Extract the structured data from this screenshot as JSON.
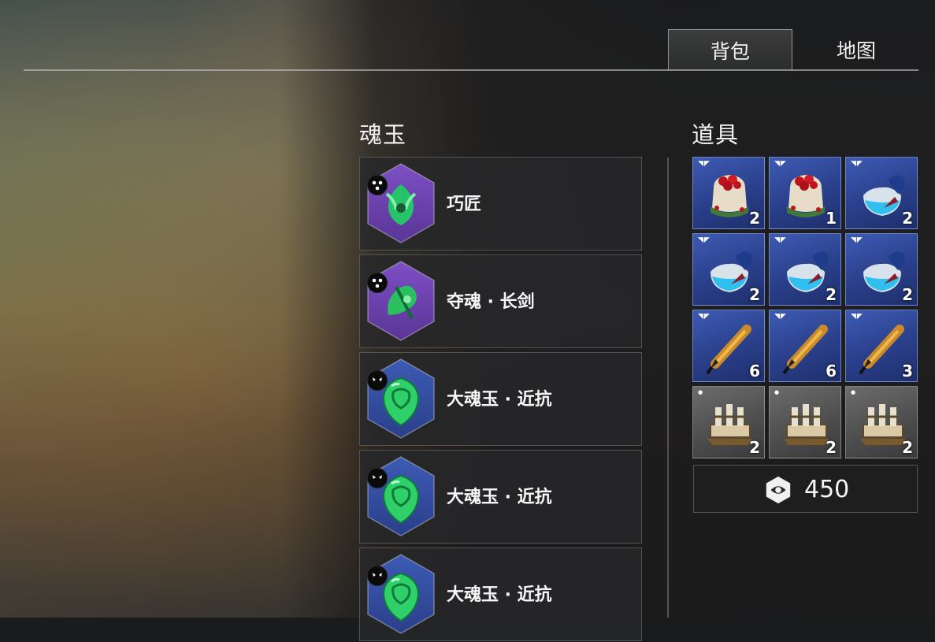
{
  "tabs": [
    {
      "label": "背包",
      "active": true
    },
    {
      "label": "地图",
      "active": false
    }
  ],
  "soul_jade": {
    "title": "魂玉",
    "items": [
      {
        "name": "巧匠",
        "rarity": "purple",
        "icon": "craftsman-jade-icon"
      },
      {
        "name": "夺魂 · 长剑",
        "rarity": "purple",
        "icon": "soul-longsword-jade-icon"
      },
      {
        "name": "大魂玉 · 近抗",
        "rarity": "blue",
        "icon": "great-jade-melee-resist-icon"
      },
      {
        "name": "大魂玉 · 近抗",
        "rarity": "blue",
        "icon": "great-jade-melee-resist-icon"
      },
      {
        "name": "大魂玉 · 近抗",
        "rarity": "blue",
        "icon": "great-jade-melee-resist-icon"
      }
    ]
  },
  "items": {
    "title": "道具",
    "grid": [
      {
        "icon": "berry-bag-icon",
        "count": "2",
        "tier": "blue"
      },
      {
        "icon": "berry-bag-icon",
        "count": "1",
        "tier": "blue"
      },
      {
        "icon": "potion-flask-icon",
        "count": "2",
        "tier": "blue"
      },
      {
        "icon": "potion-flask-icon",
        "count": "2",
        "tier": "blue"
      },
      {
        "icon": "potion-flask-icon",
        "count": "2",
        "tier": "blue"
      },
      {
        "icon": "potion-flask-icon",
        "count": "2",
        "tier": "blue"
      },
      {
        "icon": "feather-dart-icon",
        "count": "6",
        "tier": "blue"
      },
      {
        "icon": "feather-dart-icon",
        "count": "6",
        "tier": "blue"
      },
      {
        "icon": "feather-dart-icon",
        "count": "3",
        "tier": "blue"
      },
      {
        "icon": "trap-device-icon",
        "count": "2",
        "tier": "gray"
      },
      {
        "icon": "trap-device-icon",
        "count": "2",
        "tier": "gray"
      },
      {
        "icon": "trap-device-icon",
        "count": "2",
        "tier": "gray"
      }
    ]
  },
  "currency": {
    "icon": "soul-currency-icon",
    "value": "450"
  },
  "colors": {
    "purple_rarity": "#7d4fc4",
    "blue_rarity": "#3d5bb3",
    "gray_tier": "#5a5a5a",
    "jade_green": "#2fd06a"
  }
}
